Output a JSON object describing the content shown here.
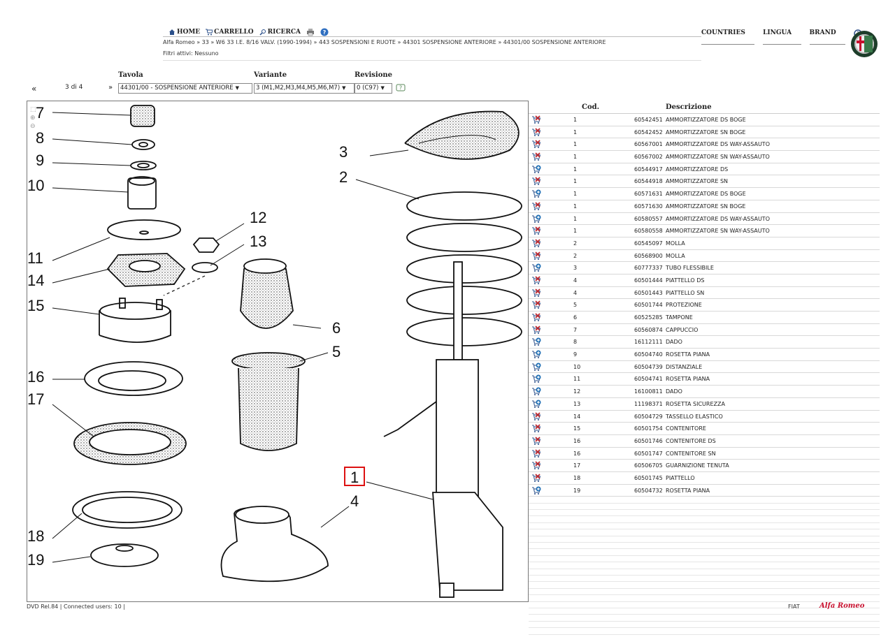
{
  "nav": {
    "home": "HOME",
    "cart": "CARRELLO",
    "search": "RICERCA",
    "breadcrumb": "Alfa Romeo » 33 » W6 33 I.E. 8/16 VALV. (1990-1994) » 443 SOSPENSIONI E RUOTE » 44301 SOSPENSIONE ANTERIORE » 44301/00 SOSPENSIONE ANTERIORE",
    "filters": "Filtri attivi: Nessuno"
  },
  "menu": {
    "countries": "COUNTRIES",
    "lingua": "LINGUA",
    "brand": "BRAND"
  },
  "selector": {
    "prev": "«",
    "pages": "3 di 4",
    "next": "»",
    "tavola_label": "Tavola",
    "tavola_value": "44301/00 - SOSPENSIONE ANTERIORE",
    "variante_label": "Variante",
    "variante_value": "3 (M1,M2,M3,M4,M5,M6,M7)",
    "revisione_label": "Revisione",
    "revisione_value": "0 (C97)"
  },
  "diagram_labels": [
    "7",
    "8",
    "9",
    "10",
    "11",
    "14",
    "15",
    "16",
    "17",
    "18",
    "19",
    "12",
    "13",
    "6",
    "5",
    "3",
    "2",
    "1",
    "4"
  ],
  "table": {
    "col_cod": "Cod.",
    "col_desc": "Descrizione",
    "rows": [
      {
        "icon": "cart-x",
        "ref": "1",
        "code": "60542451",
        "desc": "AMMORTIZZATORE DS BOGE"
      },
      {
        "icon": "cart-x",
        "ref": "1",
        "code": "60542452",
        "desc": "AMMORTIZZATORE SN BOGE"
      },
      {
        "icon": "cart-x",
        "ref": "1",
        "code": "60567001",
        "desc": "AMMORTIZZATORE DS WAY-ASSAUTO"
      },
      {
        "icon": "cart-x",
        "ref": "1",
        "code": "60567002",
        "desc": "AMMORTIZZATORE SN WAY-ASSAUTO"
      },
      {
        "icon": "cart-add",
        "ref": "1",
        "code": "60544917",
        "desc": "AMMORTIZZATORE DS"
      },
      {
        "icon": "cart-x",
        "ref": "1",
        "code": "60544918",
        "desc": "AMMORTIZZATORE SN"
      },
      {
        "icon": "cart-add",
        "ref": "1",
        "code": "60571631",
        "desc": "AMMORTIZZATORE DS BOGE"
      },
      {
        "icon": "cart-x",
        "ref": "1",
        "code": "60571630",
        "desc": "AMMORTIZZATORE SN BOGE"
      },
      {
        "icon": "cart-add",
        "ref": "1",
        "code": "60580557",
        "desc": "AMMORTIZZATORE DS WAY-ASSAUTO"
      },
      {
        "icon": "cart-x",
        "ref": "1",
        "code": "60580558",
        "desc": "AMMORTIZZATORE SN WAY-ASSAUTO"
      },
      {
        "icon": "cart-x",
        "ref": "2",
        "code": "60545097",
        "desc": "MOLLA"
      },
      {
        "icon": "cart-x",
        "ref": "2",
        "code": "60568900",
        "desc": "MOLLA"
      },
      {
        "icon": "cart-add",
        "ref": "3",
        "code": "60777337",
        "desc": "TUBO FLESSIBILE"
      },
      {
        "icon": "cart-x",
        "ref": "4",
        "code": "60501444",
        "desc": "PIATTELLO DS"
      },
      {
        "icon": "cart-x",
        "ref": "4",
        "code": "60501443",
        "desc": "PIATTELLO SN"
      },
      {
        "icon": "cart-x",
        "ref": "5",
        "code": "60501744",
        "desc": "PROTEZIONE"
      },
      {
        "icon": "cart-x",
        "ref": "6",
        "code": "60525285",
        "desc": "TAMPONE"
      },
      {
        "icon": "cart-x",
        "ref": "7",
        "code": "60560874",
        "desc": "CAPPUCCIO"
      },
      {
        "icon": "cart-add",
        "ref": "8",
        "code": "16112111",
        "desc": "DADO"
      },
      {
        "icon": "cart-add",
        "ref": "9",
        "code": "60504740",
        "desc": "ROSETTA PIANA"
      },
      {
        "icon": "cart-add",
        "ref": "10",
        "code": "60504739",
        "desc": "DISTANZIALE"
      },
      {
        "icon": "cart-add",
        "ref": "11",
        "code": "60504741",
        "desc": "ROSETTA PIANA"
      },
      {
        "icon": "cart-add",
        "ref": "12",
        "code": "16100811",
        "desc": "DADO"
      },
      {
        "icon": "cart-add",
        "ref": "13",
        "code": "11198371",
        "desc": "ROSETTA SICUREZZA"
      },
      {
        "icon": "cart-x",
        "ref": "14",
        "code": "60504729",
        "desc": "TASSELLO ELASTICO"
      },
      {
        "icon": "cart-x",
        "ref": "15",
        "code": "60501754",
        "desc": "CONTENITORE"
      },
      {
        "icon": "cart-x",
        "ref": "16",
        "code": "60501746",
        "desc": "CONTENITORE DS"
      },
      {
        "icon": "cart-x",
        "ref": "16",
        "code": "60501747",
        "desc": "CONTENITORE SN"
      },
      {
        "icon": "cart-x",
        "ref": "17",
        "code": "60506705",
        "desc": "GUARNIZIONE TENUTA"
      },
      {
        "icon": "cart-x",
        "ref": "18",
        "code": "60501745",
        "desc": "PIATTELLO"
      },
      {
        "icon": "cart-add",
        "ref": "19",
        "code": "60504732",
        "desc": "ROSETTA PIANA"
      }
    ]
  },
  "footer": {
    "status": "DVD Rel.84 |   Connected users: 10  |",
    "fiat": "FIAT",
    "brand": "Alfa Romeo"
  },
  "colors": {
    "cart_x": "#c0282e",
    "cart_add": "#1f6fb5",
    "highlight": "#d11"
  }
}
